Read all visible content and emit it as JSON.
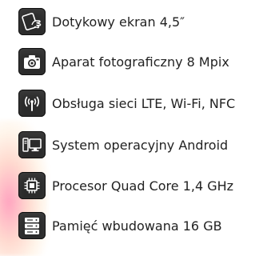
{
  "features": [
    {
      "icon": "touchscreen-hand-icon",
      "label": "Dotykowy ekran 4,5″"
    },
    {
      "icon": "camera-icon",
      "label": "Aparat fotograficzny 8 Mpix"
    },
    {
      "icon": "wireless-signal-icon",
      "label": "Obsługa sieci LTE, Wi-Fi, NFC"
    },
    {
      "icon": "desktop-computer-icon",
      "label": "System operacyjny Android"
    },
    {
      "icon": "processor-chip-icon",
      "label": "Procesor Quad Core 1,4 GHz"
    },
    {
      "icon": "server-storage-icon",
      "label": "Pamięć wbudowana 16 GB"
    }
  ],
  "colors": {
    "icon_background": "#2b2b2b",
    "text": "#222222",
    "accent_glow": "#ff5a8c"
  }
}
